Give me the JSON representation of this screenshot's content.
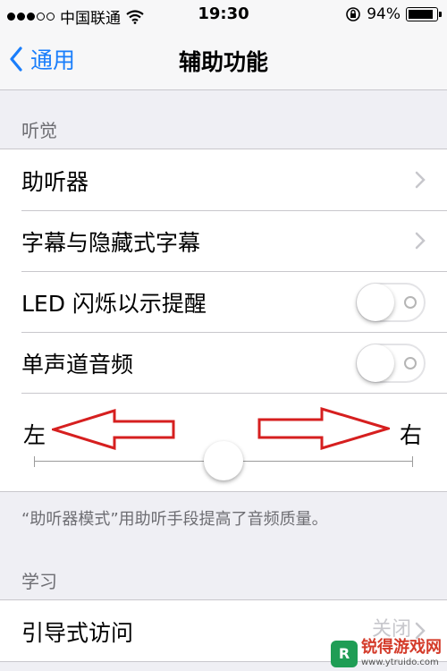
{
  "status_bar": {
    "carrier": "中国联通",
    "time": "19:30",
    "battery": "94%",
    "battery_level": 0.94,
    "signal_bars": 3,
    "signal_total": 5
  },
  "nav": {
    "back_label": "通用",
    "title": "辅助功能"
  },
  "hearing": {
    "header": "听觉",
    "rows": [
      {
        "label": "助听器"
      },
      {
        "label": "字幕与隐藏式字幕"
      }
    ],
    "toggles": [
      {
        "label": "LED 闪烁以示提醒",
        "on": false
      },
      {
        "label": "单声道音频",
        "on": false
      }
    ],
    "balance": {
      "left_label": "左",
      "right_label": "右",
      "value": 0.5
    },
    "footer": "“助听器模式”用助听手段提高了音频质量。"
  },
  "learning": {
    "header": "学习",
    "rows": [
      {
        "label": "引导式访问",
        "value": "关闭"
      }
    ]
  },
  "watermark": {
    "logo_text": "R",
    "title": "锐得游戏网",
    "url": "www.ytruido.com"
  },
  "colors": {
    "accent": "#1a7efb",
    "annotation_arrow": "#d61f1f",
    "background": "#efeff4"
  },
  "icons": [
    "chevron-left-icon",
    "wifi-icon",
    "orientation-lock-icon",
    "battery-icon",
    "chevron-right-icon"
  ]
}
